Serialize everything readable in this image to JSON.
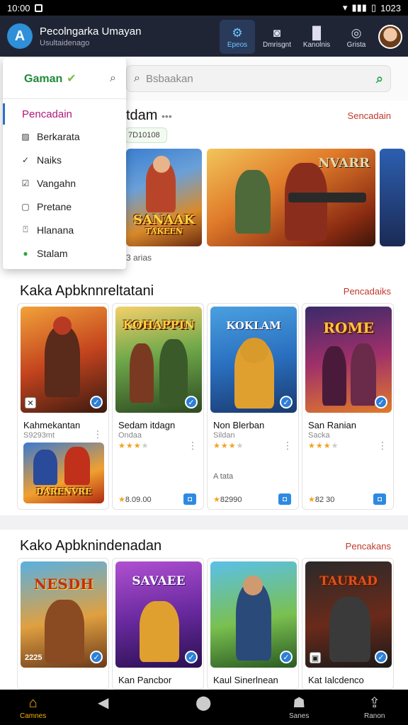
{
  "status_bar": {
    "time": "10:00",
    "right_text": "1023"
  },
  "app": {
    "title": "Pecolngarka Umayan",
    "subtitle": "Usultaidenago",
    "nav": [
      {
        "label": "Epeos",
        "icon": "controller-icon",
        "active": true
      },
      {
        "label": "Dmrisgnt",
        "icon": "camera-icon",
        "active": false
      },
      {
        "label": "Kanolnis",
        "icon": "bookmark-icon",
        "active": false
      },
      {
        "label": "Grista",
        "icon": "target-icon",
        "active": false
      }
    ]
  },
  "search": {
    "placeholder": "Bsbaakan"
  },
  "dropdown": {
    "selected_label": "Gaman",
    "heading": "Pencadain",
    "items": [
      {
        "label": "Berkarata",
        "icon": "image-icon"
      },
      {
        "label": "Naiks",
        "icon": "check-icon"
      },
      {
        "label": "Vangahn",
        "icon": "check-circle-icon"
      },
      {
        "label": "Pretane",
        "icon": "square-icon"
      },
      {
        "label": "Hlanana",
        "icon": "info-box-icon"
      },
      {
        "label": "Stalam",
        "icon": "green-check-icon"
      }
    ]
  },
  "section1": {
    "title": "tdam",
    "more": "Sencadain",
    "chip": "7D10108",
    "caption": "3 arias",
    "banners": [
      {
        "title": "SANAAK",
        "subtitle": "TAKEEN"
      },
      {
        "title": "NVARR",
        "subtitle": ""
      }
    ]
  },
  "section2": {
    "title": "Kaka Apbknnreltatani",
    "more": "Pencadaiks",
    "games": [
      {
        "name": "Kahmekantan",
        "sub": "S9293mt",
        "art": "",
        "price": ""
      },
      {
        "name": "Sedam itdagn",
        "sub": "Ondaa",
        "art": "KOHAPPIN",
        "price": "8.09.00"
      },
      {
        "name": "Non Blerban",
        "sub": "Sildan",
        "art": "KOKLAM",
        "price": "82990",
        "extra": "A tata"
      },
      {
        "name": "San Ranian",
        "sub": "Sacka",
        "art": "ROME",
        "price": "82 30"
      }
    ],
    "extra_thumb_art": "DARENVRE"
  },
  "section3": {
    "title": "Kako Apbknindenadan",
    "more": "Pencakans",
    "games": [
      {
        "name": "",
        "art": "NESDH",
        "art_caption": "2225"
      },
      {
        "name": "Kan Pancbor",
        "art": "SAVAEE"
      },
      {
        "name": "Kaul Sinerlnean",
        "art": ""
      },
      {
        "name": "Kat Ialcdenco",
        "art": "TAURAD"
      }
    ]
  },
  "bottom_nav": [
    {
      "label": "Camnes",
      "icon": "home-icon"
    },
    {
      "label": "",
      "icon": "back-icon"
    },
    {
      "label": "",
      "icon": "circle-icon"
    },
    {
      "label": "Sanes",
      "icon": "person-icon"
    },
    {
      "label": "Ranon",
      "icon": "share-icon"
    }
  ]
}
